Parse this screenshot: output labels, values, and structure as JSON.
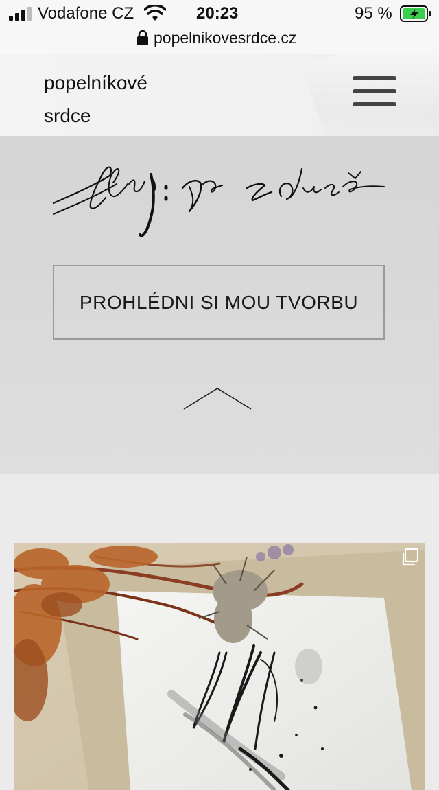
{
  "status_bar": {
    "carrier": "Vodafone CZ",
    "time": "20:23",
    "battery": "95 %",
    "battery_level": 0.95
  },
  "url_bar": {
    "url": "popelnikovesrdce.cz"
  },
  "header": {
    "title_line1": "popelníkové",
    "title_line2": "srdce",
    "menu_icon": "hamburger-icon"
  },
  "hero": {
    "cta_label": "PROHLÉDNI SI MOU TVORBU",
    "scroll_icon": "chevron-up-icon"
  },
  "gallery": {
    "overlay_icon": "multiple-images-icon"
  }
}
